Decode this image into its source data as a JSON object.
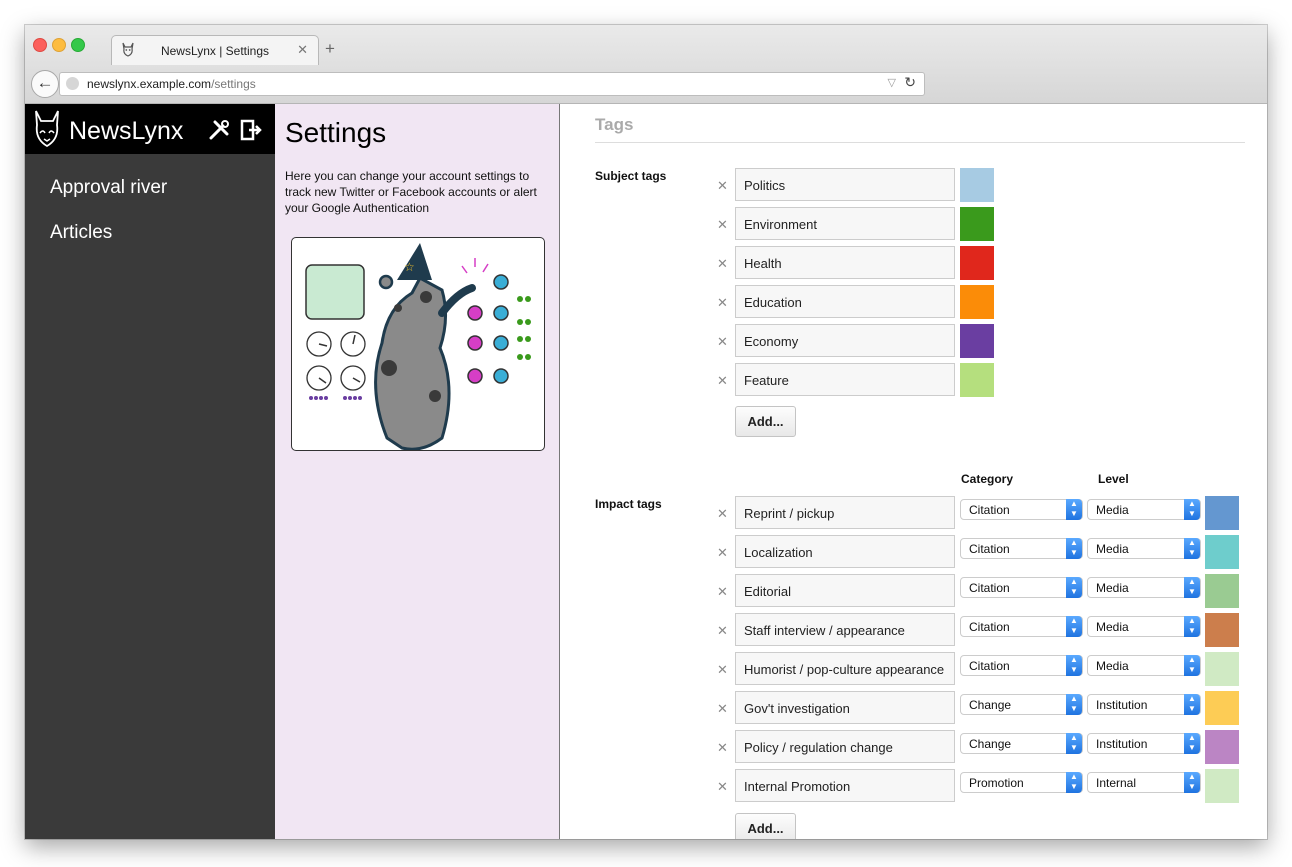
{
  "browser": {
    "tab_title": "NewsLynx | Settings",
    "url_host": "newslynx.example.com",
    "url_path": "/settings"
  },
  "brand": {
    "name": "NewsLynx"
  },
  "nav": {
    "items": [
      "Approval river",
      "Articles"
    ]
  },
  "settings": {
    "title": "Settings",
    "description": "Here you can change your account settings to track new Twitter or Facebook accounts or alert your Google Authentication"
  },
  "tags": {
    "title": "Tags",
    "subject_label": "Subject tags",
    "impact_label": "Impact tags",
    "category_header": "Category",
    "level_header": "Level",
    "add_label": "Add...",
    "subject": [
      {
        "name": "Politics",
        "color": "#a7cbe3"
      },
      {
        "name": "Environment",
        "color": "#3a9a1c"
      },
      {
        "name": "Health",
        "color": "#e0271c"
      },
      {
        "name": "Education",
        "color": "#fb8c08"
      },
      {
        "name": "Economy",
        "color": "#6a3ea1"
      },
      {
        "name": "Feature",
        "color": "#b5df7e"
      }
    ],
    "impact": [
      {
        "name": "Reprint / pickup",
        "category": "Citation",
        "level": "Media",
        "color": "#6497d0"
      },
      {
        "name": "Localization",
        "category": "Citation",
        "level": "Media",
        "color": "#6ecdcc"
      },
      {
        "name": "Editorial",
        "category": "Citation",
        "level": "Media",
        "color": "#9acb92"
      },
      {
        "name": "Staff interview / appearance",
        "category": "Citation",
        "level": "Media",
        "color": "#cc7e4c"
      },
      {
        "name": "Humorist / pop-culture appearance",
        "category": "Citation",
        "level": "Media",
        "color": "#d0eac4"
      },
      {
        "name": "Gov't investigation",
        "category": "Change",
        "level": "Institution",
        "color": "#fdcc55"
      },
      {
        "name": "Policy / regulation change",
        "category": "Change",
        "level": "Institution",
        "color": "#bb85c4"
      },
      {
        "name": "Internal Promotion",
        "category": "Promotion",
        "level": "Internal",
        "color": "#d0eac4"
      }
    ]
  }
}
